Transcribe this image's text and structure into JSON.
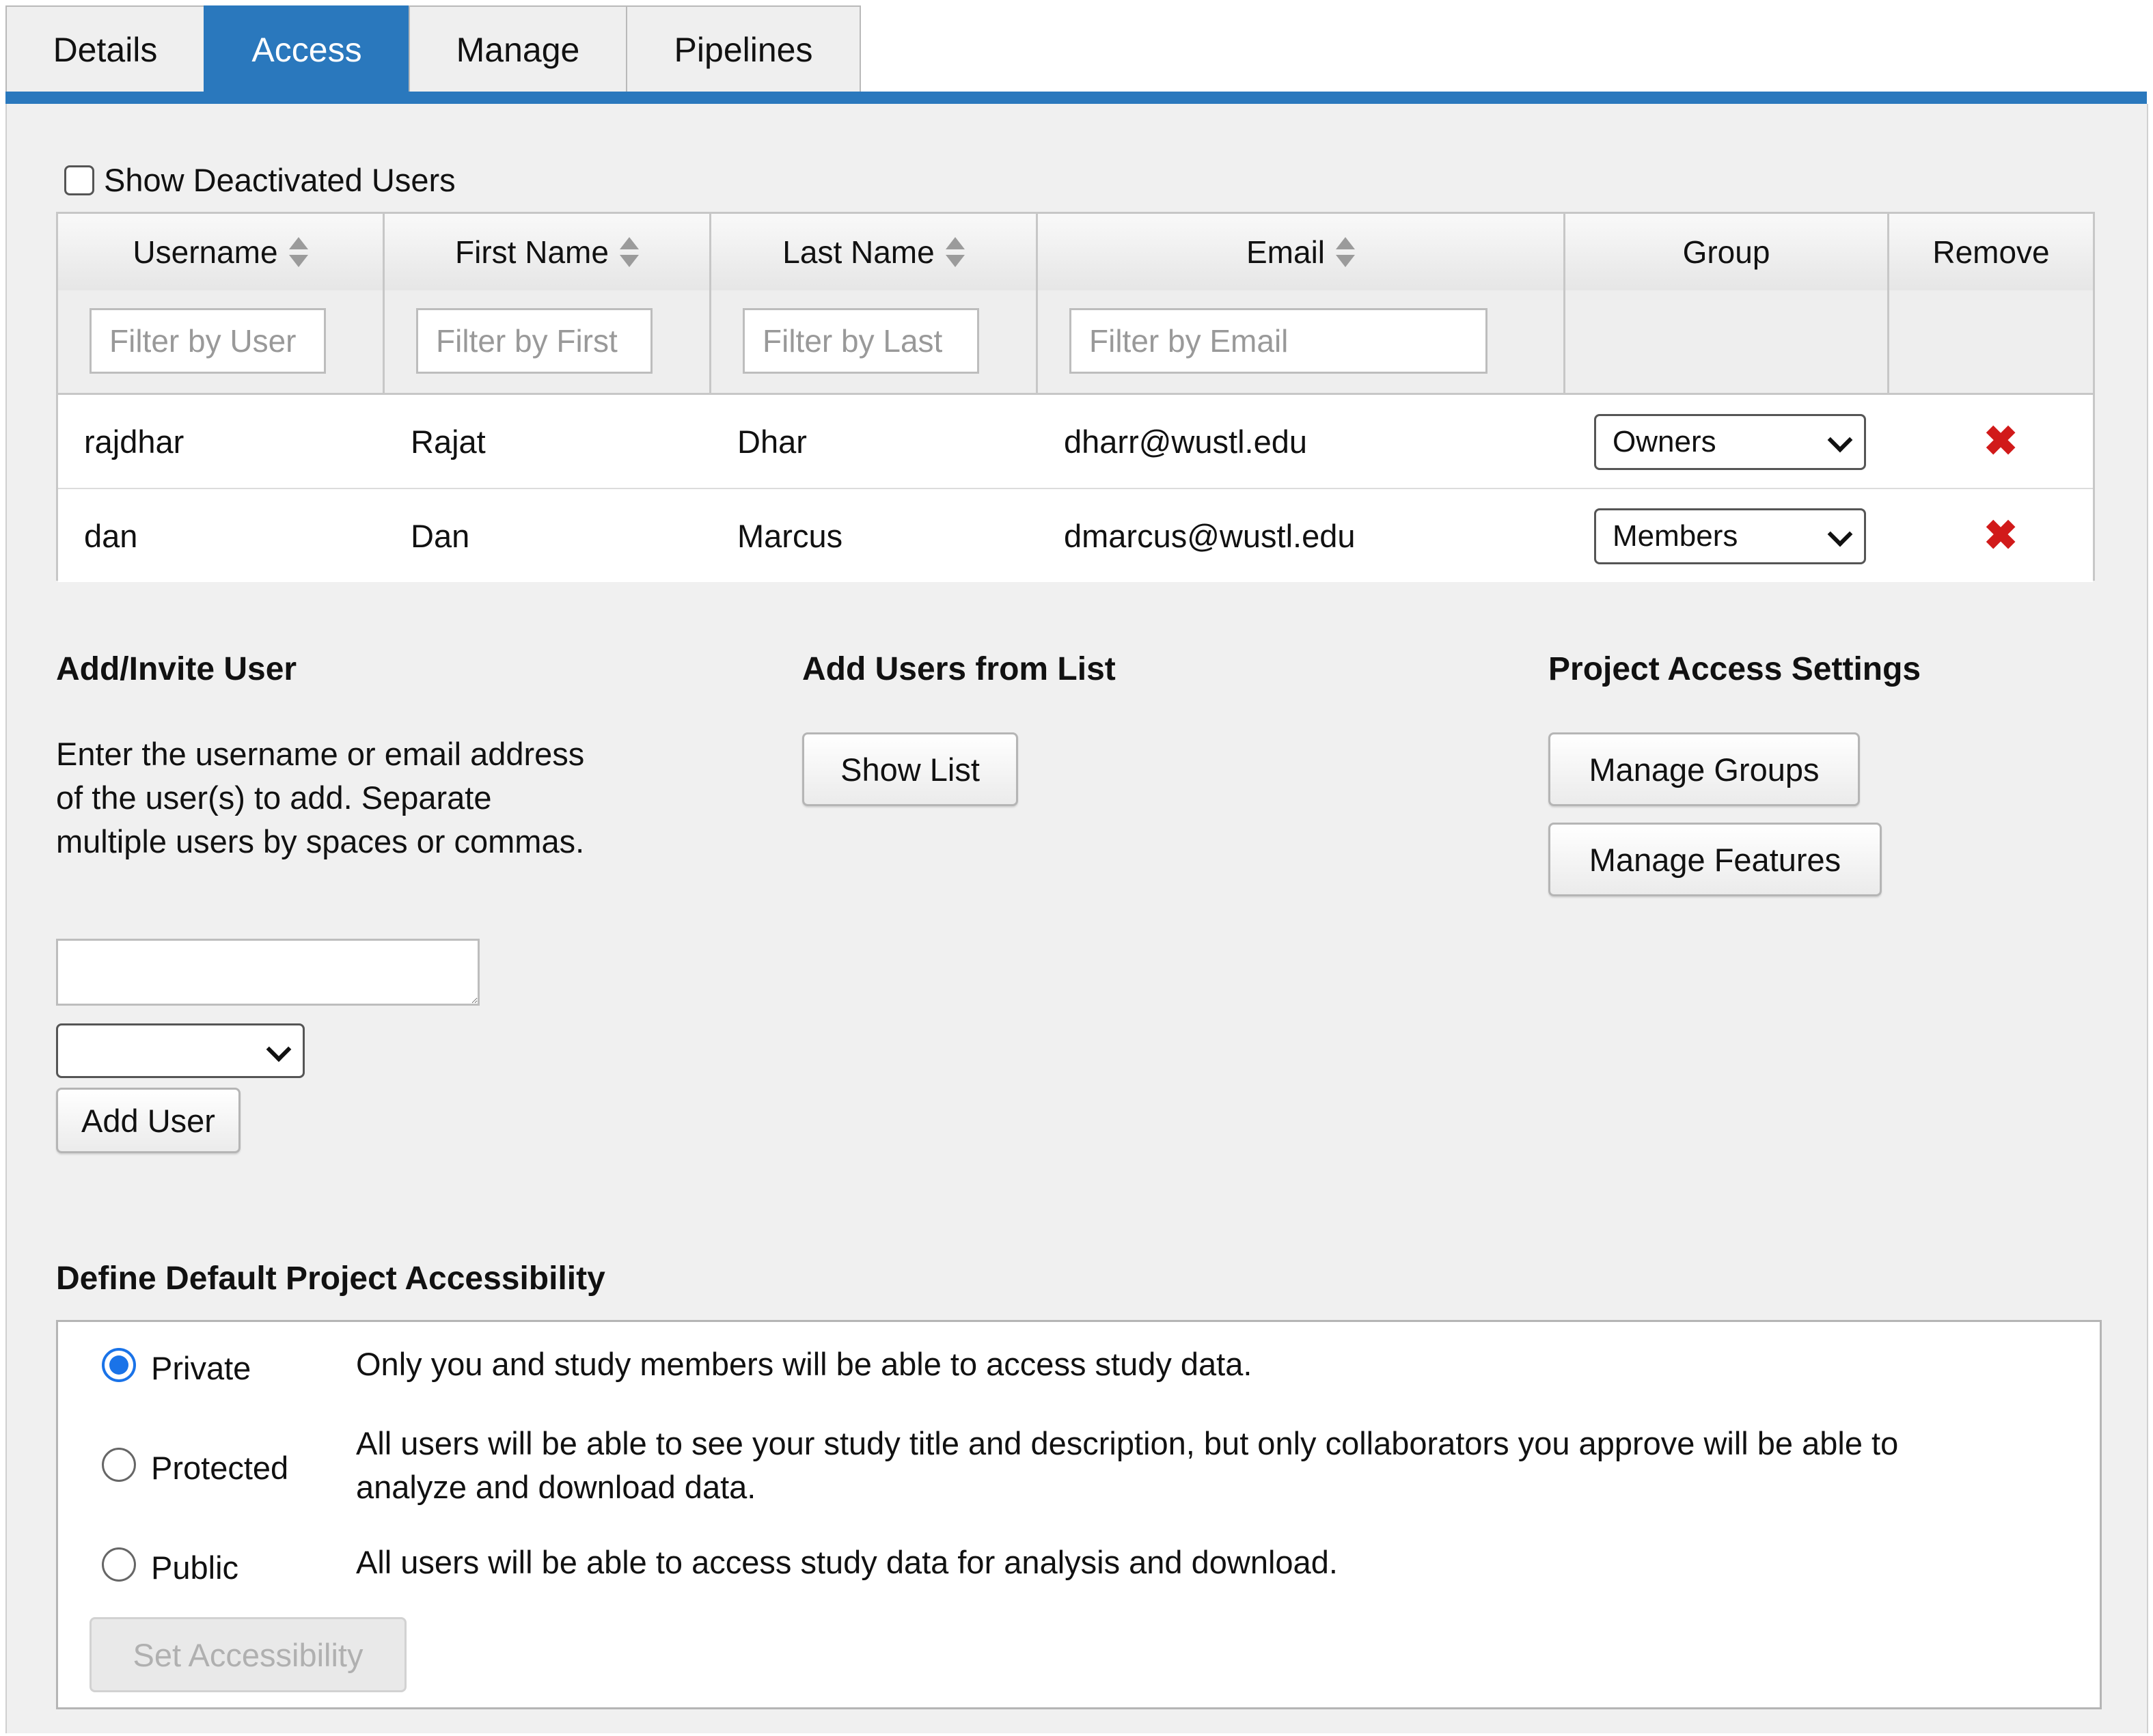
{
  "tabs": [
    {
      "label": "Details",
      "active": false
    },
    {
      "label": "Access",
      "active": true
    },
    {
      "label": "Manage",
      "active": false
    },
    {
      "label": "Pipelines",
      "active": false
    }
  ],
  "accent_color": "#2a78bd",
  "show_deactivated": {
    "label": "Show Deactivated Users",
    "checked": false
  },
  "table": {
    "headers": [
      "Username",
      "First Name",
      "Last Name",
      "Email",
      "Group",
      "Remove"
    ],
    "filters": {
      "username": "Filter by User",
      "first": "Filter by First",
      "last": "Filter by Last",
      "email": "Filter by Email"
    },
    "rows": [
      {
        "username": "rajdhar",
        "first": "Rajat",
        "last": "Dhar",
        "email": "dharr@wustl.edu",
        "group": "Owners",
        "remove_icon": "red-x"
      },
      {
        "username": "dan",
        "first": "Dan",
        "last": "Marcus",
        "email": "dmarcus@wustl.edu",
        "group": "Members",
        "remove_icon": "red-x"
      }
    ]
  },
  "add_invite": {
    "title": "Add/Invite User",
    "instructions": "Enter the username or email address of the user(s) to add. Separate multiple users by spaces or commas.",
    "textarea_value": "",
    "group_select_value": "",
    "button": "Add User"
  },
  "add_from_list": {
    "title": "Add Users from List",
    "button": "Show List"
  },
  "access_settings": {
    "title": "Project Access Settings",
    "buttons": [
      "Manage Groups",
      "Manage Features"
    ]
  },
  "accessibility": {
    "title": "Define Default Project Accessibility",
    "options": [
      {
        "label": "Private",
        "description": "Only you and study members will be able to access study data.",
        "checked": true
      },
      {
        "label": "Protected",
        "description": "All users will be able to see your study title and description, but only collaborators you approve will be able to analyze and download data.",
        "checked": false
      },
      {
        "label": "Public",
        "description": "All users will be able to access study data for analysis and download.",
        "checked": false
      }
    ],
    "button": "Set Accessibility",
    "button_disabled": true
  }
}
